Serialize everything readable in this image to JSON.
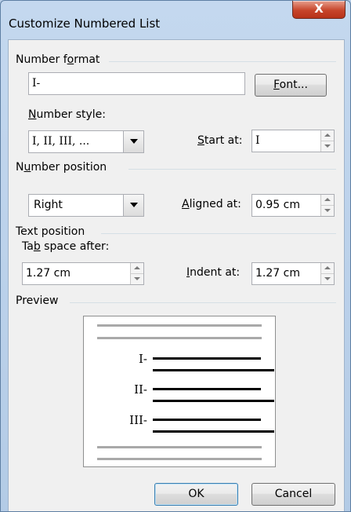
{
  "window": {
    "title": "Customize Numbered List",
    "close_glyph": "X"
  },
  "number_format": {
    "group_label_pre": "Number f",
    "group_label_accel": "o",
    "group_label_post": "rmat",
    "value": "I-",
    "font_button_accel": "F",
    "font_button_rest": "ont..."
  },
  "number_style": {
    "label_accel": "N",
    "label_rest": "umber style:",
    "value": "I, II, III, ...",
    "start_at_accel": "S",
    "start_at_rest": "tart at:",
    "start_at_value": "I"
  },
  "number_position": {
    "group_label_pre": "N",
    "group_label_accel": "u",
    "group_label_post": "mber position",
    "alignment_value": "Right",
    "aligned_at_accel": "A",
    "aligned_at_rest": "ligned at:",
    "aligned_at_value": "0.95 cm"
  },
  "text_position": {
    "group_label": "Text position",
    "tab_space_pre": "Ta",
    "tab_space_accel": "b",
    "tab_space_post": " space after:",
    "tab_space_value": "1.27 cm",
    "indent_at_accel": "I",
    "indent_at_rest": "ndent at:",
    "indent_at_value": "1.27 cm"
  },
  "preview": {
    "group_label": "Preview",
    "items": [
      "I-",
      "II-",
      "III-"
    ]
  },
  "buttons": {
    "ok": "OK",
    "cancel": "Cancel"
  },
  "colors": {
    "title_bar": "#b9cee8",
    "close_button": "#c7452b",
    "dialog_bg": "#f0f0f0"
  }
}
